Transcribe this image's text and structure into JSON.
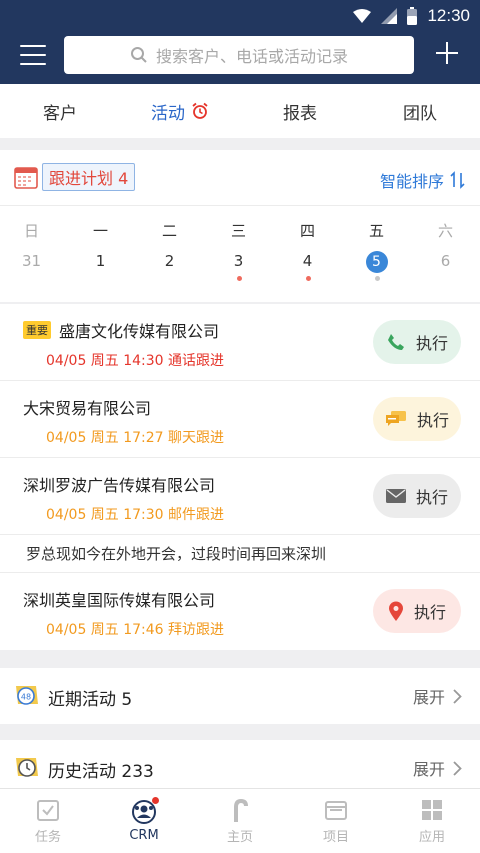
{
  "status": {
    "time": "12:30"
  },
  "search": {
    "placeholder": "搜索客户、电话或活动记录"
  },
  "tabs": [
    {
      "label": "客户"
    },
    {
      "label": "活动"
    },
    {
      "label": "报表"
    },
    {
      "label": "团队"
    }
  ],
  "plan": {
    "title": "跟进计划 4",
    "sort_label": "智能排序"
  },
  "week": [
    {
      "name": "日",
      "date": "31"
    },
    {
      "name": "一",
      "date": "1"
    },
    {
      "name": "二",
      "date": "2"
    },
    {
      "name": "三",
      "date": "3"
    },
    {
      "name": "四",
      "date": "4"
    },
    {
      "name": "五",
      "date": "5"
    },
    {
      "name": "六",
      "date": "6"
    }
  ],
  "activities": [
    {
      "tag": "重要",
      "company": "盛唐文化传媒有限公司",
      "detail": "04/05 周五 14:30 通话跟进",
      "detail_color": "#e5352b",
      "action": "执行",
      "icon": "phone-icon"
    },
    {
      "company": "大宋贸易有限公司",
      "detail": "04/05 周五 17:27 聊天跟进",
      "detail_color": "#f29a1f",
      "action": "执行",
      "icon": "chat-icon"
    },
    {
      "company": "深圳罗波广告传媒有限公司",
      "detail": "04/05 周五 17:30 邮件跟进",
      "detail_color": "#f29a1f",
      "action": "执行",
      "icon": "mail-icon",
      "note": "罗总现如今在外地开会，过段时间再回来深圳"
    },
    {
      "company": "深圳英皇国际传媒有限公司",
      "detail": "04/05 周五 17:46 拜访跟进",
      "detail_color": "#f29a1f",
      "action": "执行",
      "icon": "location-icon"
    }
  ],
  "recent": {
    "label": "近期活动 5",
    "expand": "展开",
    "icon_text": "48"
  },
  "history": {
    "label": "历史活动 233",
    "expand": "展开"
  },
  "bottom_nav": [
    {
      "label": "任务"
    },
    {
      "label": "CRM"
    },
    {
      "label": "主页"
    },
    {
      "label": "项目"
    },
    {
      "label": "应用"
    }
  ],
  "colors": {
    "header": "#22375f",
    "accent": "#2a66c8",
    "urgent": "#e5352b",
    "pending": "#f29a1f"
  }
}
